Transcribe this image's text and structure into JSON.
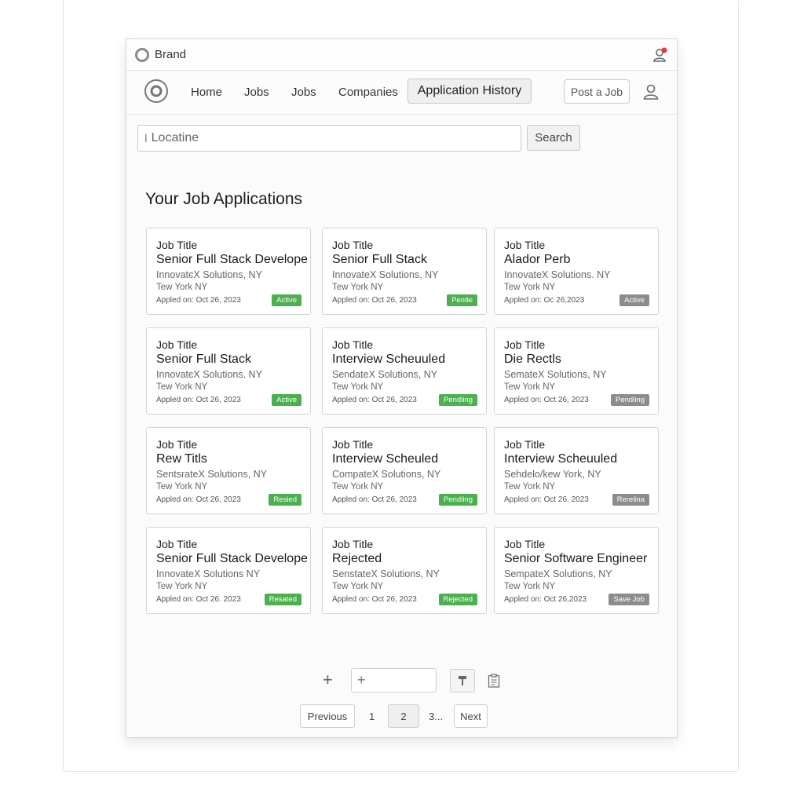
{
  "titlebar": {
    "brand": "Brand",
    "notification_color": "#e53935"
  },
  "nav": {
    "links": [
      "Home",
      "Jobs",
      "Jobs",
      "Companies"
    ],
    "active": "Application History",
    "post_job": "Post a Job"
  },
  "search": {
    "value": "Locatine",
    "button": "Search"
  },
  "section_title": "Your Job Applications",
  "cards": [
    {
      "label": "Job Title",
      "title": "Senior Full Stack Developer",
      "company": "InnovatєX Solutions, NY",
      "location": "Tew York NY",
      "date": "Appled on: Oct 26, 2023",
      "status": "Active",
      "status_color": "green"
    },
    {
      "label": "Job Title",
      "title": "Senior Full Stack",
      "company": "InnovateX Solutions, NY",
      "location": "Tew York NY",
      "date": "Appled on: Oct 26, 2023",
      "status": "Pentle",
      "status_color": "green"
    },
    {
      "label": "Job Title",
      "title": "Alador Perb",
      "company": "InnovateX Solutions. NY",
      "location": "Tew York NY",
      "date": "Appled on: Oc 26,2023",
      "status": "Active",
      "status_color": "gray"
    },
    {
      "label": "Job Title",
      "title": "Senior Full Stack",
      "company": "InnovatєX Solutions. NY",
      "location": "Tew York NY",
      "date": "Appled on: Oct 26, 2023",
      "status": "Active",
      "status_color": "green"
    },
    {
      "label": "Job Title",
      "title": "Interview Scheuuled",
      "company": "SendateX Solutions, NY",
      "location": "Tew York NY",
      "date": "Appled on: Oct 26, 2023",
      "status": "Pendling",
      "status_color": "green"
    },
    {
      "label": "Job Title",
      "title": "Die Rectls",
      "company": "SemateX Solutions, NY",
      "location": "Tew York NY",
      "date": "Appled on: Oct 26, 2023",
      "status": "Pendling",
      "status_color": "gray"
    },
    {
      "label": "Job Title",
      "title": "Rew Titls",
      "company": "SentsrateX Solutions, NY",
      "location": "Tew York NY",
      "date": "Appled on: Oct 26, 2023",
      "status": "Resied",
      "status_color": "green"
    },
    {
      "label": "Job Title",
      "title": "Interview Scheuled",
      "company": "CompateX Solutions, NY",
      "location": "Tew York NY",
      "date": "Appled on: Oct 26, 2023",
      "status": "Pendling",
      "status_color": "green"
    },
    {
      "label": "Job Title",
      "title": "Interview Scheuuled",
      "company": "Sehdelo/kew York, NY",
      "location": "Tew York NY",
      "date": "Appled on: Oct 26. 2023",
      "status": "Rerelina",
      "status_color": "gray"
    },
    {
      "label": "Job Title",
      "title": "Senior Full Stack Developer",
      "company": "InnovateX Solutions NY",
      "location": "Tew York NY",
      "date": "Appled on: Oct 26. 2023",
      "status": "Resated",
      "status_color": "green"
    },
    {
      "label": "Job Title",
      "title": "Rejected",
      "company": "SenstateX Solutions, NY",
      "location": "Tew York NY",
      "date": "Appled on: Oct 26, 2023",
      "status": "Rejected",
      "status_color": "green"
    },
    {
      "label": "Job Title",
      "title": "Senior Software Engineer",
      "company": "SempateX Solutions, NY",
      "location": "Tew York NY",
      "date": "Appled on: Oct 26,2023",
      "status": "Save Job",
      "status_color": "gray"
    }
  ],
  "tools": {
    "plus": "+",
    "input_value": "+"
  },
  "pagination": {
    "previous": "Previous",
    "pages": [
      "1",
      "2",
      "3..."
    ],
    "current": "2",
    "next": "Next"
  }
}
